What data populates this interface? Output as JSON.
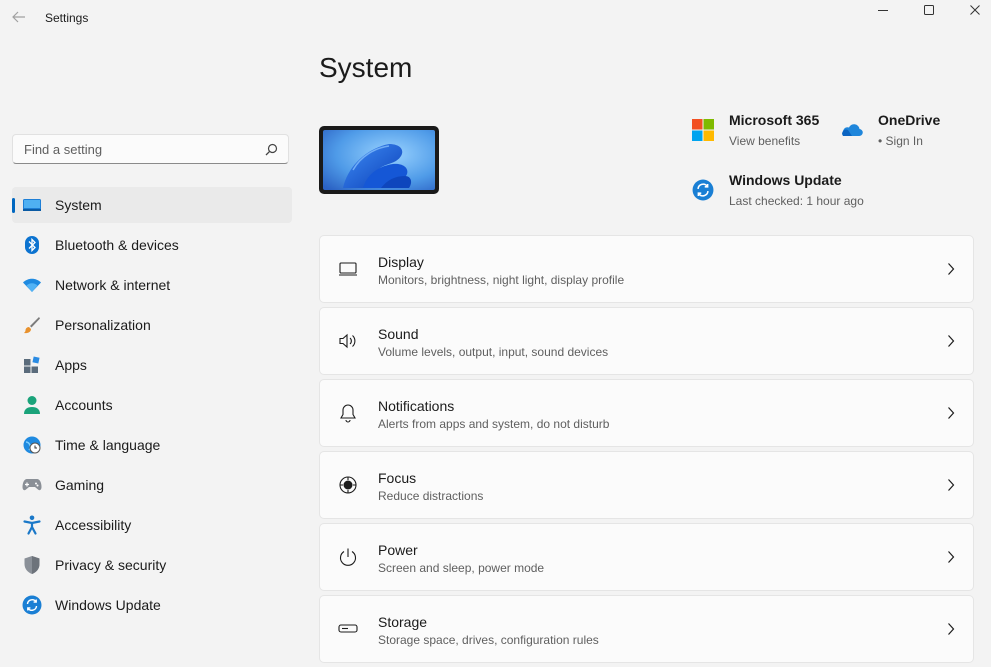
{
  "window": {
    "title": "Settings",
    "icons": {
      "back": "back-arrow-icon",
      "minimize": "minimize-icon",
      "maximize": "maximize-icon",
      "close": "close-icon"
    }
  },
  "search": {
    "placeholder": "Find a setting",
    "value": ""
  },
  "sidebar": {
    "items": [
      {
        "label": "System",
        "icon": "system-icon",
        "active": true
      },
      {
        "label": "Bluetooth & devices",
        "icon": "bluetooth-icon"
      },
      {
        "label": "Network & internet",
        "icon": "wifi-icon"
      },
      {
        "label": "Personalization",
        "icon": "brush-icon"
      },
      {
        "label": "Apps",
        "icon": "apps-icon"
      },
      {
        "label": "Accounts",
        "icon": "accounts-icon"
      },
      {
        "label": "Time & language",
        "icon": "time-language-icon"
      },
      {
        "label": "Gaming",
        "icon": "gamepad-icon"
      },
      {
        "label": "Accessibility",
        "icon": "accessibility-icon"
      },
      {
        "label": "Privacy & security",
        "icon": "shield-icon"
      },
      {
        "label": "Windows Update",
        "icon": "windows-update-icon"
      }
    ]
  },
  "main": {
    "title": "System",
    "quick_links": {
      "m365": {
        "title": "Microsoft 365",
        "subtitle": "View benefits",
        "icon": "microsoft-365-icon"
      },
      "onedrive": {
        "title": "OneDrive",
        "subtitle": "• Sign In",
        "icon": "onedrive-icon"
      },
      "update": {
        "title": "Windows Update",
        "subtitle": "Last checked: 1 hour ago",
        "icon": "windows-update-icon"
      }
    },
    "cards": [
      {
        "title": "Display",
        "subtitle": "Monitors, brightness, night light, display profile",
        "icon": "display-icon"
      },
      {
        "title": "Sound",
        "subtitle": "Volume levels, output, input, sound devices",
        "icon": "sound-icon"
      },
      {
        "title": "Notifications",
        "subtitle": "Alerts from apps and system, do not disturb",
        "icon": "bell-icon"
      },
      {
        "title": "Focus",
        "subtitle": "Reduce distractions",
        "icon": "focus-icon"
      },
      {
        "title": "Power",
        "subtitle": "Screen and sleep, power mode",
        "icon": "power-icon"
      },
      {
        "title": "Storage",
        "subtitle": "Storage space, drives, configuration rules",
        "icon": "storage-icon"
      }
    ]
  },
  "colors": {
    "accent": "#0067c0",
    "background": "#f3f3f3",
    "card": "#fbfbfb"
  }
}
